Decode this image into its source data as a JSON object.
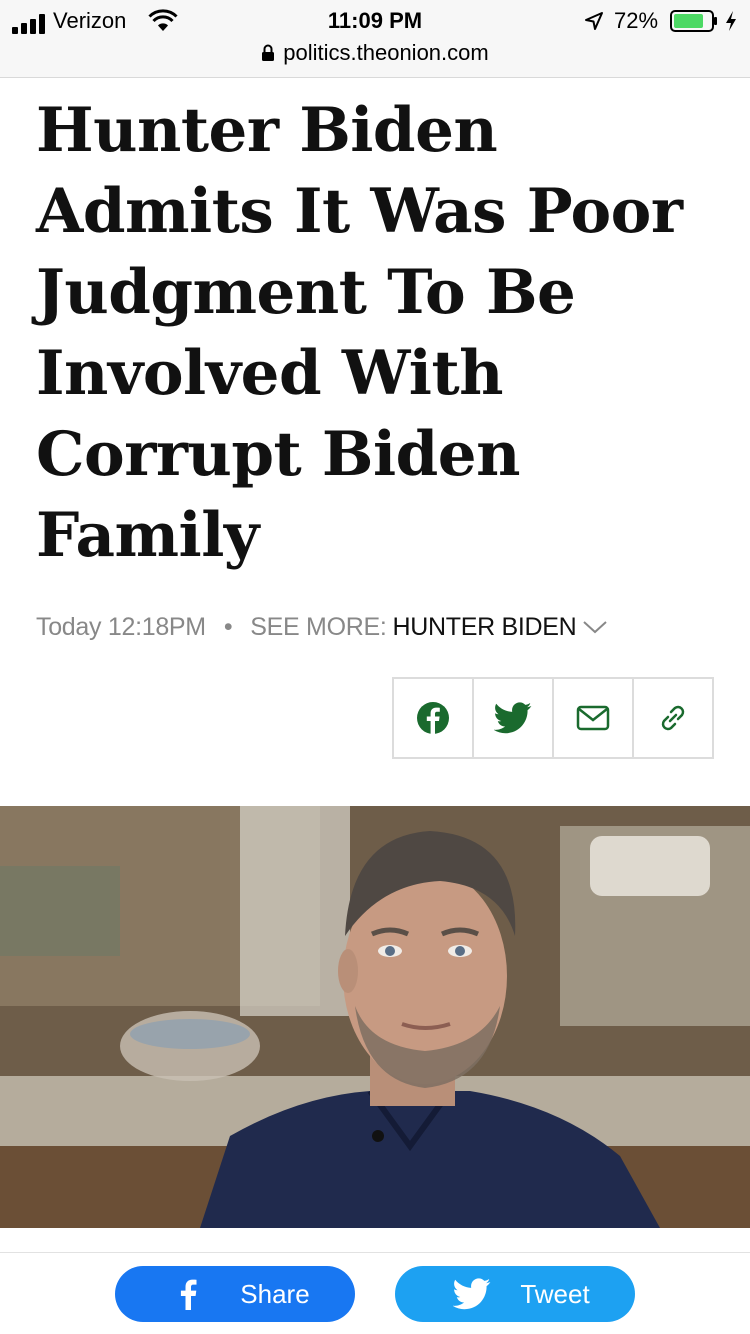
{
  "status_bar": {
    "carrier": "Verizon",
    "time": "11:09 PM",
    "battery": "72%",
    "url": "politics.theonion.com"
  },
  "article": {
    "headline": "Hunter Biden Admits It Was Poor Judgment To Be Involved With Corrupt Biden Family",
    "timestamp": "Today 12:18PM",
    "separator": "•",
    "see_more_label": "SEE MORE:",
    "tag": "HUNTER BIDEN"
  },
  "share_icons": [
    "facebook-icon",
    "twitter-icon",
    "email-icon",
    "link-icon"
  ],
  "bottom_bar": {
    "facebook_label": "Share",
    "twitter_label": "Tweet"
  },
  "colors": {
    "accent_green": "#1a6a2e",
    "facebook_blue": "#1877f2",
    "twitter_blue": "#1da1f2"
  }
}
